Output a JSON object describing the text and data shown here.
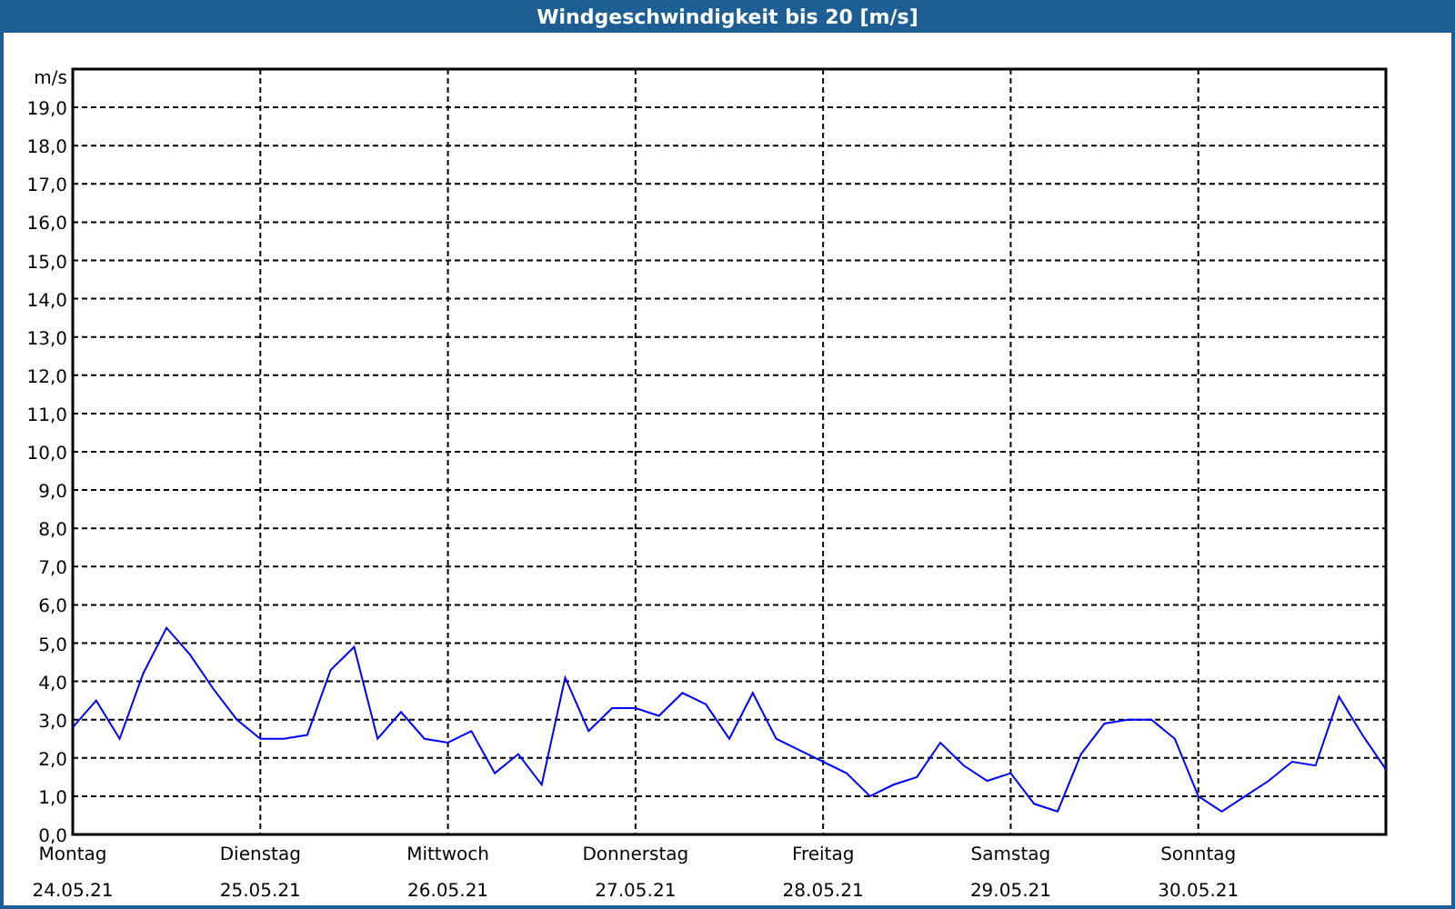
{
  "window": {
    "title": "Windgeschwindigkeit bis 20 [m/s]"
  },
  "chart": {
    "chart_data": {
      "type": "line",
      "grid": true,
      "ylabel": "m/s",
      "ylim": [
        0,
        20
      ],
      "categories": [
        "Montag 24.05.21",
        null,
        null,
        null,
        null,
        null,
        null,
        null,
        "Dienstag 25.05.21",
        null,
        null,
        null,
        null,
        null,
        null,
        null,
        "Mittwoch 26.05.21",
        null,
        null,
        null,
        null,
        null,
        null,
        null,
        "Donnerstag 27.05.21",
        null,
        null,
        null,
        null,
        null,
        null,
        null,
        "Freitag 28.05.21",
        null,
        null,
        null,
        null,
        null,
        null,
        null,
        "Samstag 29.05.21",
        null,
        null,
        null,
        null,
        null,
        null,
        null,
        "Sonntag 30.05.21",
        null,
        null,
        null,
        null,
        null,
        null,
        null,
        null
      ],
      "series": [
        {
          "color": "#0000ff",
          "values": [
            2.8,
            3.5,
            2.5,
            4.2,
            5.4,
            4.7,
            3.8,
            3.0,
            2.5,
            2.5,
            2.6,
            4.3,
            4.9,
            2.5,
            3.2,
            2.5,
            2.4,
            2.7,
            1.6,
            2.1,
            1.3,
            4.1,
            2.7,
            3.3,
            3.3,
            3.1,
            3.7,
            3.4,
            2.5,
            3.7,
            2.5,
            2.2,
            1.9,
            1.6,
            1.0,
            1.3,
            1.5,
            2.4,
            1.8,
            1.4,
            1.6,
            0.8,
            0.6,
            2.1,
            2.9,
            3.0,
            3.0,
            2.5,
            1.0,
            0.6,
            1.0,
            1.4,
            1.9,
            1.8,
            3.6,
            2.6,
            1.7
          ]
        }
      ],
      "yticks": [
        {
          "value": 0,
          "label": "0,0"
        },
        {
          "value": 1,
          "label": "1,0"
        },
        {
          "value": 2,
          "label": "2,0"
        },
        {
          "value": 3,
          "label": "3,0"
        },
        {
          "value": 4,
          "label": "4,0"
        },
        {
          "value": 5,
          "label": "5,0"
        },
        {
          "value": 6,
          "label": "6,0"
        },
        {
          "value": 7,
          "label": "7,0"
        },
        {
          "value": 8,
          "label": "8,0"
        },
        {
          "value": 9,
          "label": "9,0"
        },
        {
          "value": 10,
          "label": "10,0"
        },
        {
          "value": 11,
          "label": "11,0"
        },
        {
          "value": 12,
          "label": "12,0"
        },
        {
          "value": 13,
          "label": "13,0"
        },
        {
          "value": 14,
          "label": "14,0"
        },
        {
          "value": 15,
          "label": "15,0"
        },
        {
          "value": 16,
          "label": "16,0"
        },
        {
          "value": 17,
          "label": "17,0"
        },
        {
          "value": 18,
          "label": "18,0"
        },
        {
          "value": 19,
          "label": "19,0"
        }
      ]
    }
  }
}
